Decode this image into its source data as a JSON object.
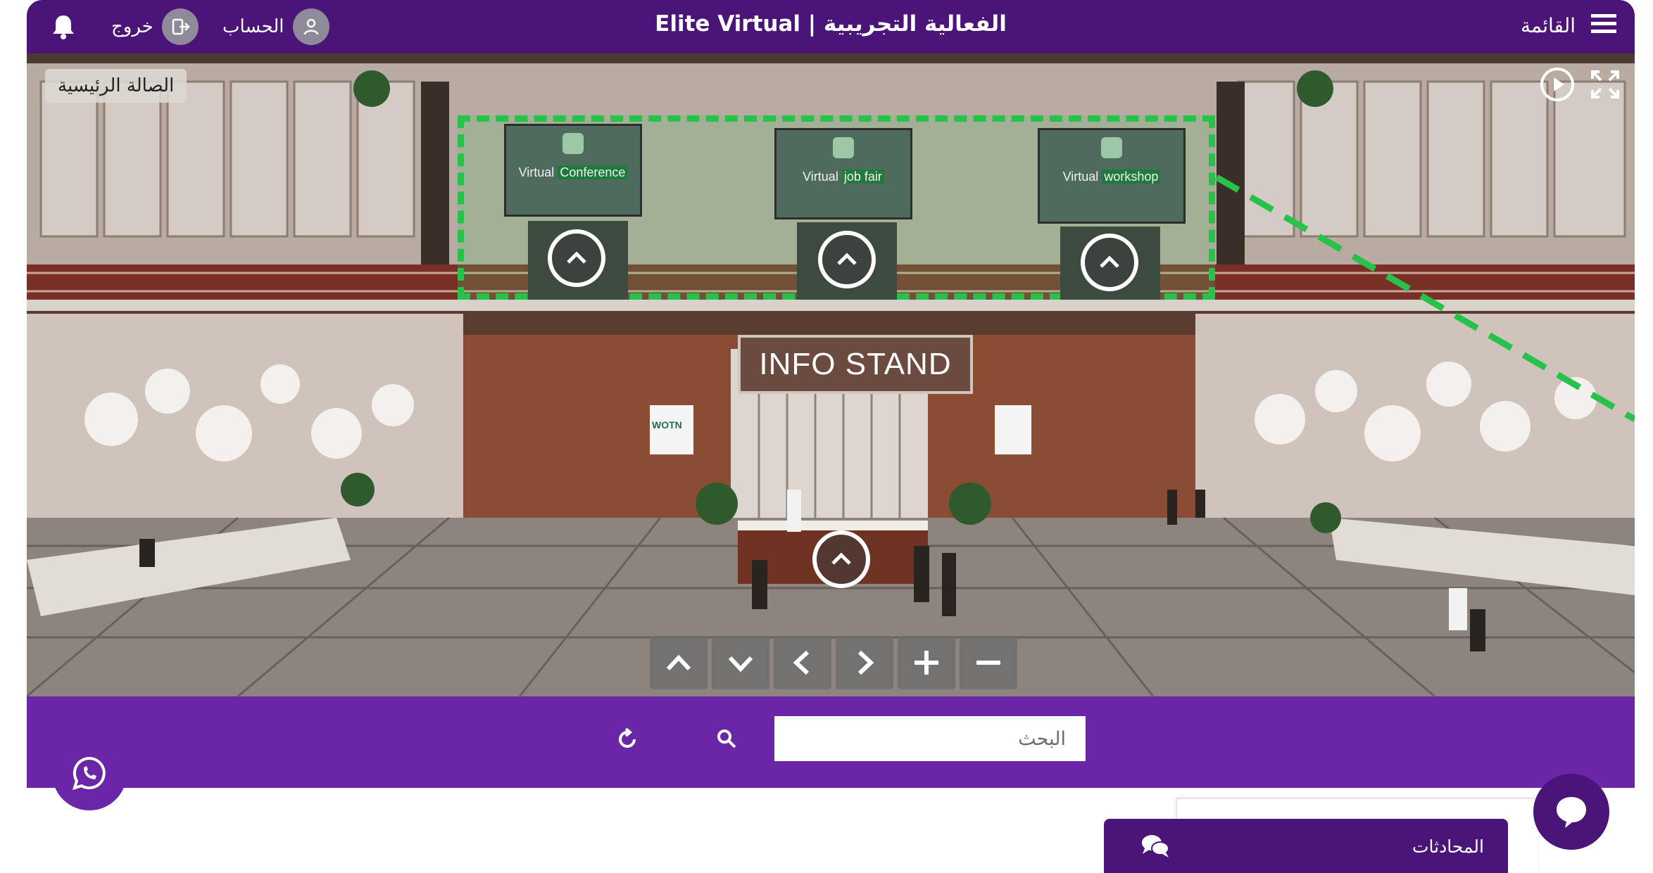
{
  "header": {
    "title": "Elite Virtual | الفعالية التجريبية",
    "menu_label": "القائمة",
    "account_label": "الحساب",
    "logout_label": "خروج"
  },
  "scene": {
    "hall_label": "الصالة الرئيسية",
    "info_stand": "INFO STAND",
    "screens": [
      {
        "first": "Virtual",
        "highlight": "Conference"
      },
      {
        "first": "Virtual",
        "highlight": "job fair"
      },
      {
        "first": "Virtual",
        "highlight": "workshop"
      }
    ],
    "side_sign": "WOTN",
    "nav_icons": [
      "chevron-up-icon",
      "chevron-down-icon",
      "chevron-left-icon",
      "chevron-right-icon",
      "zoom-in-icon",
      "zoom-out-icon"
    ]
  },
  "search": {
    "placeholder": "البحث"
  },
  "chat": {
    "label": "المحادثات"
  },
  "colors": {
    "header": "#4a1479",
    "searchbar": "#6a26a7",
    "highlight": "#27c24a"
  }
}
